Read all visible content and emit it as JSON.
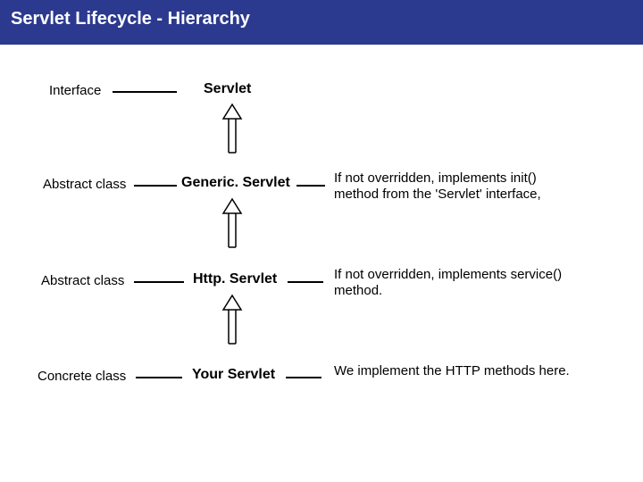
{
  "title": "Servlet Lifecycle - Hierarchy",
  "rows": [
    {
      "left": "Interface",
      "center": "Servlet",
      "note": ""
    },
    {
      "left": "Abstract class",
      "center": "Generic. Servlet",
      "note": "If not overridden, implements init() method from the 'Servlet' interface,"
    },
    {
      "left": "Abstract class",
      "center": "Http. Servlet",
      "note": "If not overridden, implements service() method."
    },
    {
      "left": "Concrete class",
      "center": "Your Servlet",
      "note": "We implement the HTTP methods here."
    }
  ]
}
